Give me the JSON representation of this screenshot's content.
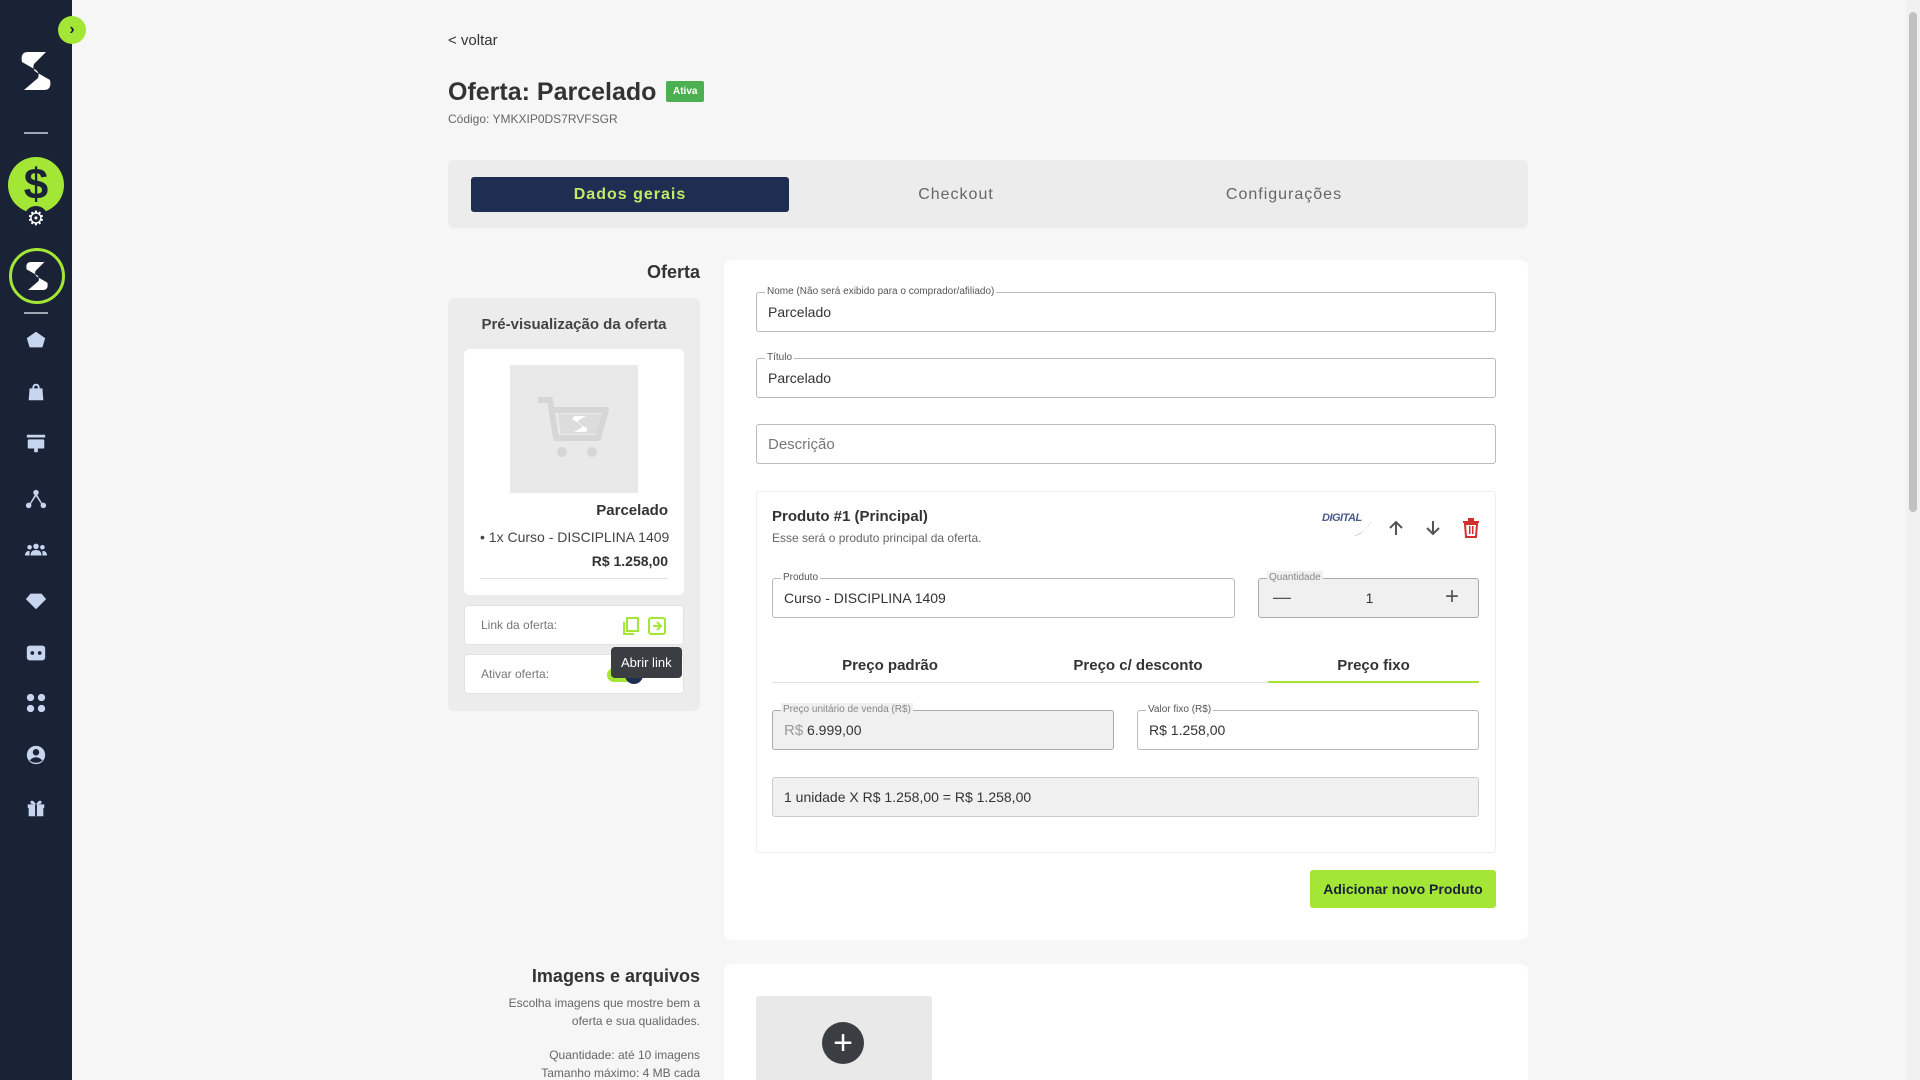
{
  "sidebar": {
    "expand_glyph": "›",
    "money_glyph": "$",
    "gear_glyph": "⚙",
    "icons": [
      "home-icon",
      "bag-icon",
      "sales-icon",
      "network-icon",
      "users-icon",
      "diamond-icon",
      "card-icon",
      "apps-icon",
      "profile-icon",
      "gift-icon"
    ],
    "accent_color": "#a3e635",
    "background_color": "#1a2236"
  },
  "header": {
    "back_label": "< voltar",
    "title": "Oferta: Parcelado",
    "status_badge": "Ativa",
    "code": "Código: YMKXIP0DS7RVFSGR"
  },
  "tabs": [
    {
      "label": "Dados gerais",
      "active": true
    },
    {
      "label": "Checkout",
      "active": false
    },
    {
      "label": "Configurações",
      "active": false
    }
  ],
  "oferta_section": {
    "label": "Oferta",
    "preview": {
      "title": "Pré-visualização da oferta",
      "name": "Parcelado",
      "item": "• 1x Curso - DISCIPLINA 1409",
      "price": "R$ 1.258,00",
      "link_label": "Link da oferta:",
      "activate_label": "Ativar oferta:",
      "tooltip": "Abrir link"
    },
    "fields": {
      "nome_label": "Nome (Não será exibido para o comprador/afiliado)",
      "nome_value": "Parcelado",
      "titulo_label": "Título",
      "titulo_value": "Parcelado",
      "descricao_placeholder": "Descrição"
    },
    "product": {
      "title": "Produto #1 (Principal)",
      "subtitle": "Esse será o produto principal da oferta.",
      "badge": "DIGITAL",
      "produto_label": "Produto",
      "produto_value": "Curso - DISCIPLINA 1409",
      "quantidade_label": "Quantidade",
      "quantidade_value": "1",
      "minus_glyph": "—",
      "plus_glyph": "+",
      "price_tabs": [
        {
          "label": "Preço padrão",
          "active": false
        },
        {
          "label": "Preço c/ desconto",
          "active": false
        },
        {
          "label": "Preço fixo",
          "active": true
        }
      ],
      "unit_price_label": "Preço unitário de venda (R$)",
      "unit_price_prefix": "R$",
      "unit_price_value": "6.999,00",
      "fixed_value_label": "Valor fixo (R$)",
      "fixed_value": "R$ 1.258,00",
      "total": "1 unidade X R$ 1.258,00 = R$ 1.258,00"
    },
    "add_product_button": "Adicionar novo Produto"
  },
  "images_section": {
    "label": "Imagens e arquivos",
    "description": "Escolha imagens que mostre bem a oferta e sua qualidades.",
    "quantity": "Quantidade: até 10 imagens",
    "max_size": "Tamanho máximo: 4 MB cada",
    "add_glyph": "+"
  }
}
